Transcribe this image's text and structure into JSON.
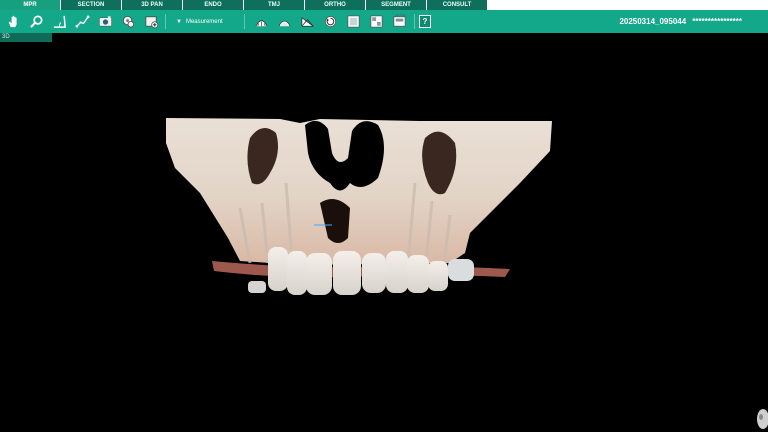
{
  "tabs": [
    {
      "label": "MPR",
      "active": true
    },
    {
      "label": "SECTION",
      "active": false
    },
    {
      "label": "3D PAN",
      "active": false
    },
    {
      "label": "ENDO",
      "active": false
    },
    {
      "label": "TMJ",
      "active": false
    },
    {
      "label": "ORTHO",
      "active": false
    },
    {
      "label": "SEGMENT",
      "active": false
    },
    {
      "label": "CONSULT",
      "active": false
    }
  ],
  "toolbar": {
    "tools": [
      {
        "name": "pan-hand-icon"
      },
      {
        "name": "zoom-icon"
      },
      {
        "name": "angle-measure-icon"
      },
      {
        "name": "line-measure-icon"
      },
      {
        "name": "capture-icon"
      },
      {
        "name": "reset-view-icon"
      },
      {
        "name": "add-view-icon"
      }
    ],
    "dropdown_label": "Measurement",
    "tools2": [
      {
        "name": "dental-arch-icon"
      },
      {
        "name": "arch-curve-icon"
      },
      {
        "name": "nerve-icon"
      },
      {
        "name": "rotate-icon"
      },
      {
        "name": "layout-icon"
      },
      {
        "name": "gallery-icon"
      },
      {
        "name": "save-icon"
      }
    ],
    "help_label": "?"
  },
  "patient": {
    "id": "20250314_095044",
    "name": "****************"
  },
  "viewport": {
    "label": "3D"
  },
  "colors": {
    "toolbar": "#13a889",
    "tab_active": "#17a07f",
    "tab_inactive": "#0d6f5c",
    "background": "#000000"
  }
}
